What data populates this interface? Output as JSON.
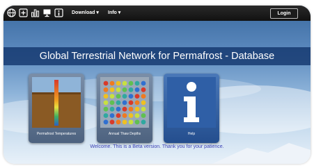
{
  "navbar": {
    "icons": [
      "globe-icon",
      "add-icon",
      "bar-chart-icon",
      "monitor-icon",
      "info-icon"
    ],
    "download_label": "Download ▾",
    "info_label": "Info ▾",
    "login_label": "Login"
  },
  "header": {
    "title": "Global Terrestrial Network for Permafrost - Database"
  },
  "tiles": [
    {
      "label": "Permafrost Temperatures",
      "icon": "temperature-borehole-icon"
    },
    {
      "label": "Annual Thaw Depths",
      "icon": "dot-grid-icon"
    },
    {
      "label": "Help",
      "icon": "info-icon"
    }
  ],
  "footer": {
    "welcome": "Welcome. This is a Beta version. Thank you for your patience."
  },
  "colors": {
    "navbar": "#111111",
    "banner": "#14376e",
    "welcome_text": "#3a3fb4",
    "help_tile": "#2f5fa6"
  }
}
